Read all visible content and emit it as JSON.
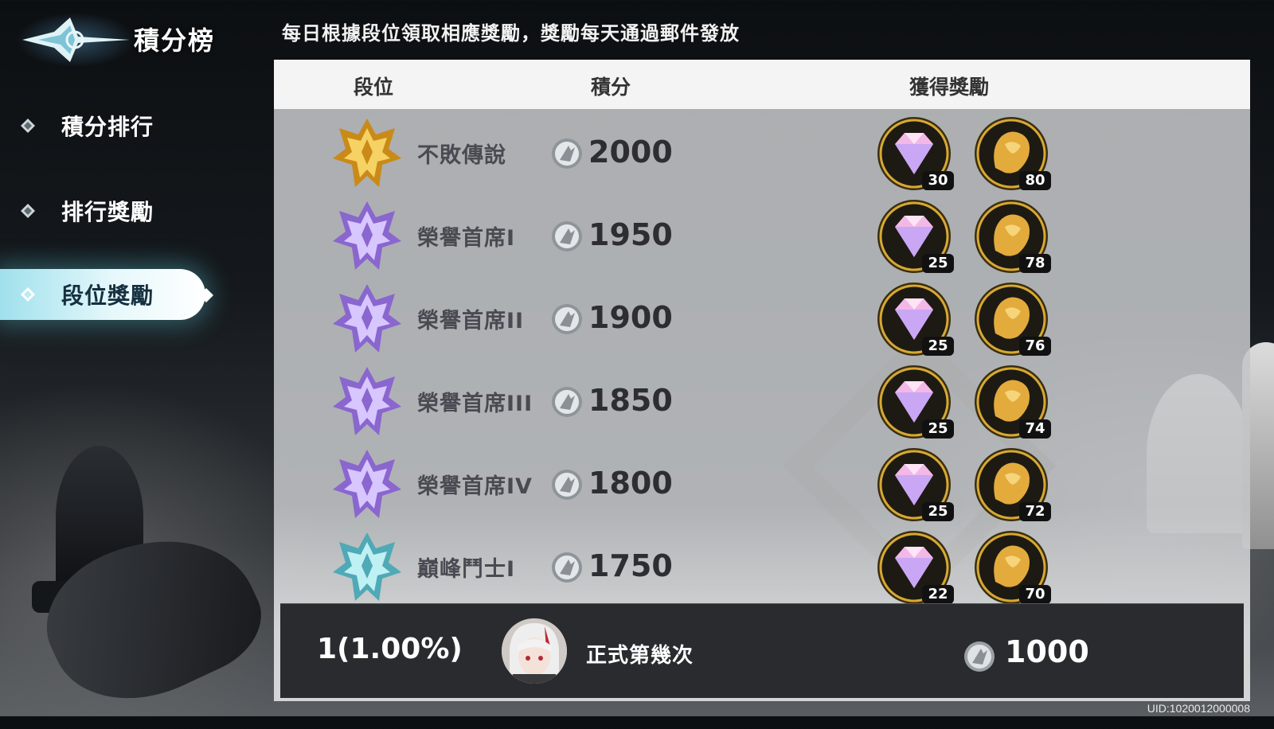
{
  "title": "積分榜",
  "instruction": "每日根據段位領取相應獎勵，獎勵每天通過郵件發放",
  "sidebar": {
    "items": [
      {
        "label": "積分排行",
        "active": false
      },
      {
        "label": "排行獎勵",
        "active": false
      },
      {
        "label": "段位獎勵",
        "active": true
      }
    ]
  },
  "table": {
    "headers": {
      "rank": "段位",
      "score": "積分",
      "reward": "獲得獎勵"
    },
    "rows": [
      {
        "name": "不敗傳說",
        "score": "2000",
        "gems": "30",
        "lion": "80",
        "tier": "gold"
      },
      {
        "name": "榮譽首席I",
        "score": "1950",
        "gems": "25",
        "lion": "78",
        "tier": "purple"
      },
      {
        "name": "榮譽首席II",
        "score": "1900",
        "gems": "25",
        "lion": "76",
        "tier": "purple"
      },
      {
        "name": "榮譽首席III",
        "score": "1850",
        "gems": "25",
        "lion": "74",
        "tier": "purple"
      },
      {
        "name": "榮譽首席IV",
        "score": "1800",
        "gems": "25",
        "lion": "72",
        "tier": "purple"
      },
      {
        "name": "巔峰鬥士I",
        "score": "1750",
        "gems": "22",
        "lion": "70",
        "tier": "teal"
      }
    ]
  },
  "my": {
    "rank": "1(1.00%)",
    "name": "正式第幾次",
    "score": "1000"
  },
  "uid": "UID:1020012000008",
  "icons": {
    "coin": "silver-coin-icon",
    "gem": "pink-diamond-icon",
    "lion": "gold-lion-icon"
  },
  "colors": {
    "accent": "#9fe0ec",
    "gold": "#e0a82a",
    "purple": "#9f7fd9",
    "teal": "#6fc3cf"
  }
}
